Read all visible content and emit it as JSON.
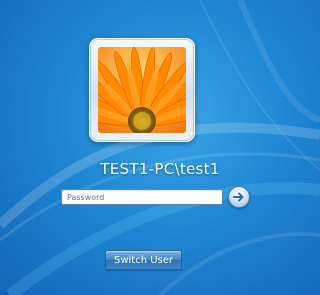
{
  "login": {
    "username": "TEST1-PC\\test1",
    "password_placeholder": "Password",
    "switch_user_label": "Switch User"
  },
  "icons": {
    "user_tile": "flower-photo",
    "submit": "arrow-right-icon"
  },
  "colors": {
    "background": "#1f86d3",
    "button": "#3f82c4"
  }
}
